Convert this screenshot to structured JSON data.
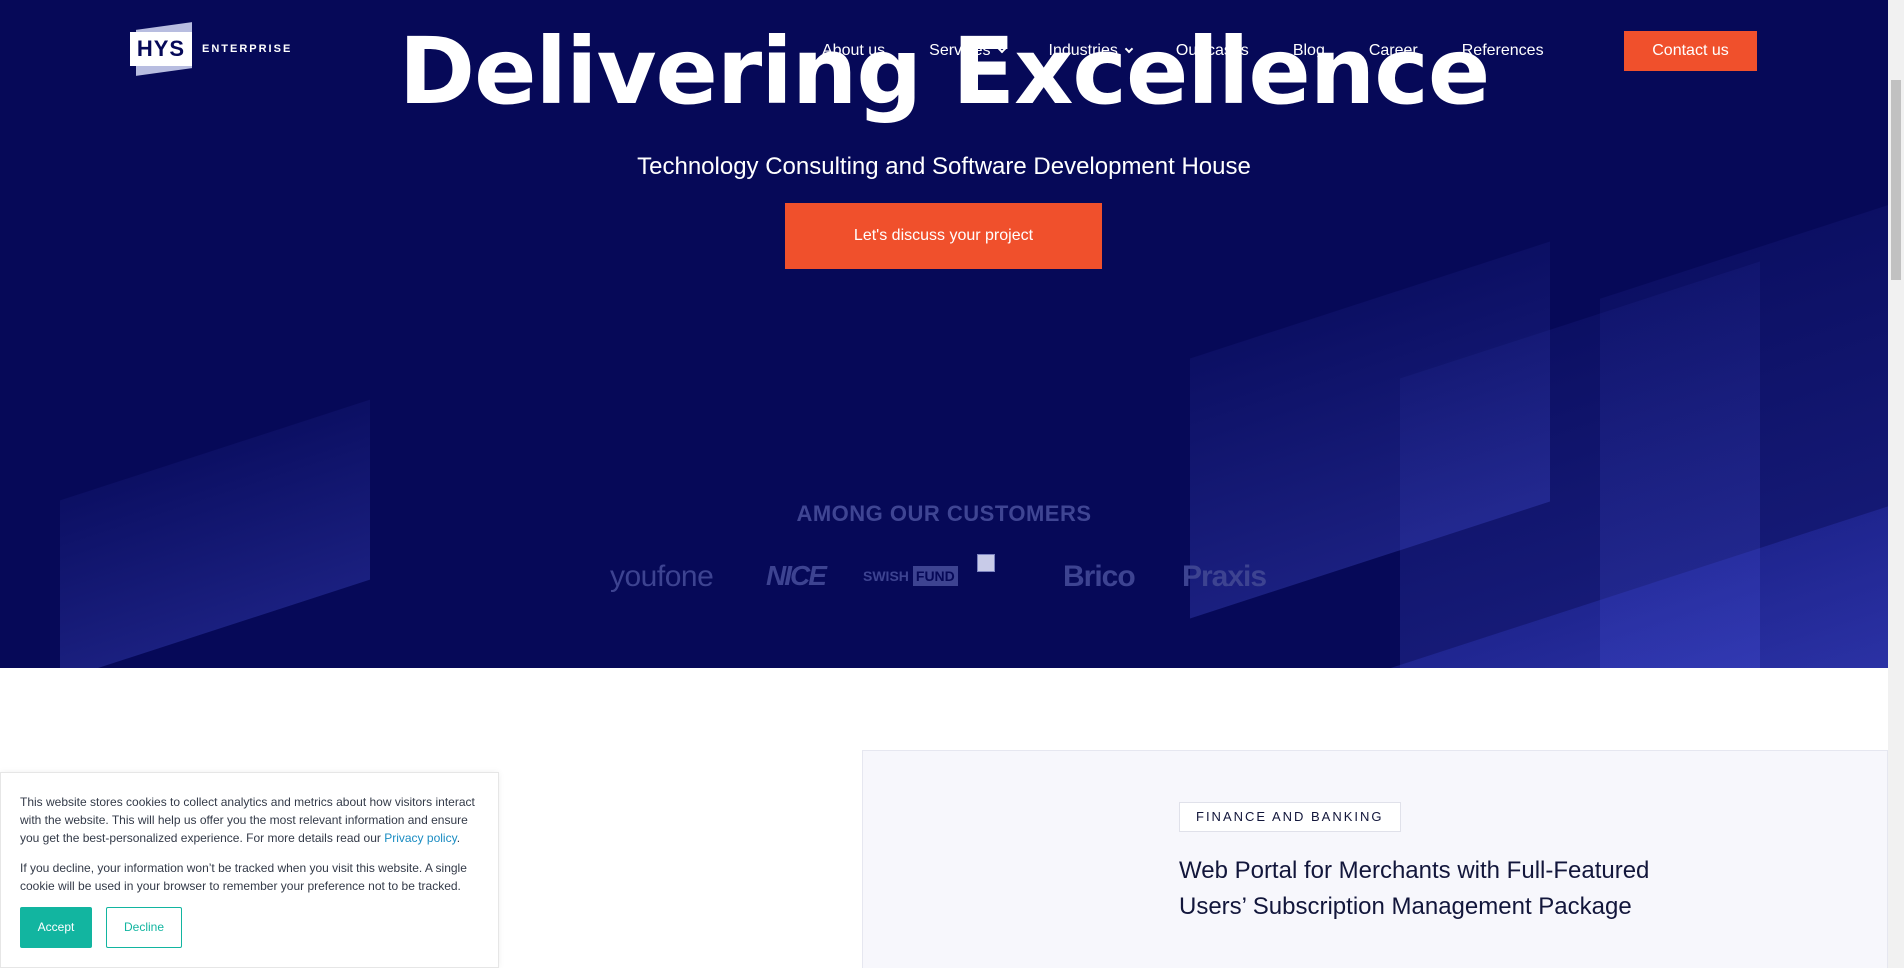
{
  "brand": {
    "logo_mark": "HYS",
    "logo_text": "ENTERPRISE"
  },
  "nav": {
    "items": [
      {
        "label": "About us",
        "dropdown": false
      },
      {
        "label": "Services",
        "dropdown": true
      },
      {
        "label": "Industries",
        "dropdown": true
      },
      {
        "label": "Our cases",
        "dropdown": false
      },
      {
        "label": "Blog",
        "dropdown": false
      },
      {
        "label": "Career",
        "dropdown": false
      },
      {
        "label": "References",
        "dropdown": false
      }
    ],
    "contact_label": "Contact us"
  },
  "hero": {
    "headline": "Delivering Excellence",
    "subheadline": "Technology Consulting and Software Development House",
    "cta_label": "Let's discuss your project",
    "customers_title": "AMONG OUR CUSTOMERS",
    "customers": {
      "youfone": "youfone",
      "nice": "NICE",
      "swish": "SWISH",
      "fund": "FUND",
      "brico": "Brico",
      "praxis": "Praxis"
    }
  },
  "case": {
    "tag": "FINANCE AND BANKING",
    "title": "Web Portal for Merchants with Full-Featured Users’ Subscription Management Package"
  },
  "cookie": {
    "text1": "This website stores cookies to collect analytics and metrics about how visitors interact with the website. This will help us offer you the most relevant information and ensure you get the best-personalized experience. For more details read our",
    "privacy_link": "Privacy policy",
    "text2": "If you decline, your information won’t be tracked when you visit this website. A single cookie will be used in your browser to remember your preference not to be tracked.",
    "accept_label": "Accept",
    "decline_label": "Decline"
  },
  "colors": {
    "hero_bg": "#060958",
    "accent_orange": "#f0502c",
    "accept_teal": "#12b5a0"
  }
}
